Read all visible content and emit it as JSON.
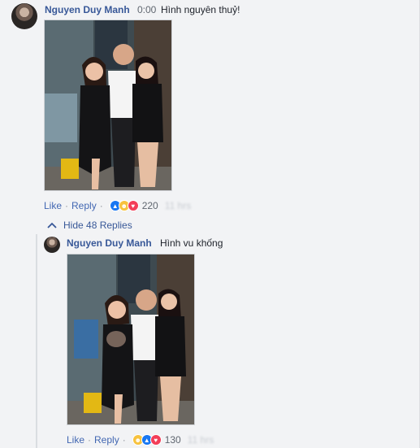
{
  "comment": {
    "author": "Nguyen Duy Manh",
    "time": "0:00",
    "text": "Hình nguyên thuỷ!",
    "actions": {
      "like": "Like",
      "separator": "·",
      "reply": "Reply",
      "reaction_count": "220",
      "age": "11 hrs"
    }
  },
  "replies_toggle": {
    "label": "Hide 48 Replies",
    "icon": "chevron-up-icon"
  },
  "reply": {
    "author": "Nguyen Duy Manh",
    "text": "Hình vu khống",
    "actions": {
      "like": "Like",
      "separator": "·",
      "reply": "Reply",
      "reaction_count": "130",
      "age": "11 hrs"
    }
  },
  "colors": {
    "link_blue": "#385898",
    "action_blue": "#4267b2",
    "background": "#f2f3f5",
    "meta_gray": "#606770"
  },
  "icons": [
    "like-reaction-icon",
    "haha-reaction-icon",
    "love-reaction-icon"
  ]
}
